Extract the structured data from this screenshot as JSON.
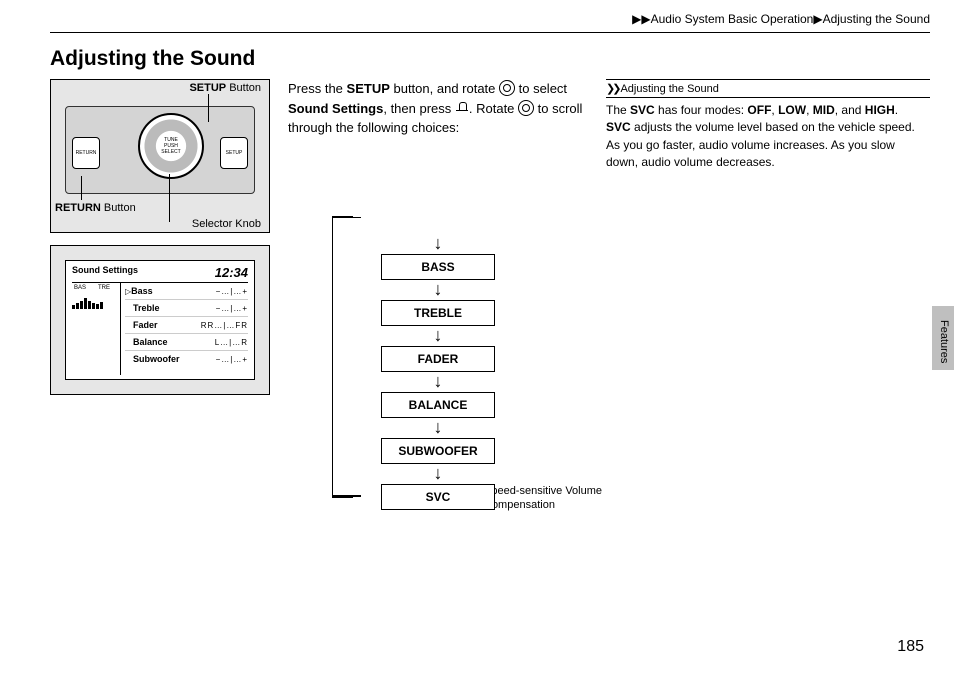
{
  "breadcrumb": {
    "sep": "▶▶",
    "a": "Audio System Basic Operation",
    "mid": "▶",
    "b": "Adjusting the Sound"
  },
  "title": "Adjusting the Sound",
  "intro": {
    "t1": "Press the ",
    "b1": "SETUP",
    "t2": " button, and rotate ",
    "t3": " to select ",
    "b2": "Sound Settings",
    "t4": ", then press ",
    "t5": ". Rotate ",
    "t6": " to scroll through the following choices:"
  },
  "panel": {
    "setup": "SETUP",
    "setup_suffix": " Button",
    "return": "RETURN",
    "return_suffix": " Button",
    "selector": "Selector Knob",
    "knob_text": "TUNE\nPUSH\nSELECT",
    "btn_return": "RETURN",
    "btn_setup": "SETUP"
  },
  "screen": {
    "title": "Sound Settings",
    "clock": "12:34",
    "bas": "BAS",
    "tre": "TRE",
    "rows": [
      {
        "label": "Bass",
        "scale": "−…|…+",
        "cursor": true
      },
      {
        "label": "Treble",
        "scale": "−…|…+"
      },
      {
        "label": "Fader",
        "scale": "RR…|…FR"
      },
      {
        "label": "Balance",
        "scale": "L…|…R"
      },
      {
        "label": "Subwoofer",
        "scale": "−…|…+"
      }
    ]
  },
  "flow": [
    "BASS",
    "TREBLE",
    "FADER",
    "BALANCE",
    "SUBWOOFER",
    "SVC"
  ],
  "svc_note": "Speed-sensitive Volume Compensation",
  "sidebar": {
    "marker": "❯❯",
    "head": "Adjusting the Sound",
    "p1a": "The ",
    "p1b": "SVC",
    "p1c": " has four modes: ",
    "m1": "OFF",
    "c": ", ",
    "m2": "LOW",
    "m3": "MID",
    "and": ", and ",
    "m4": "HIGH",
    "dot": ".",
    "p2a": "SVC",
    "p2b": " adjusts the volume level based on the vehicle speed. As you go faster, audio volume increases. As you slow down, audio volume decreases."
  },
  "tab": "Features",
  "page": "185"
}
